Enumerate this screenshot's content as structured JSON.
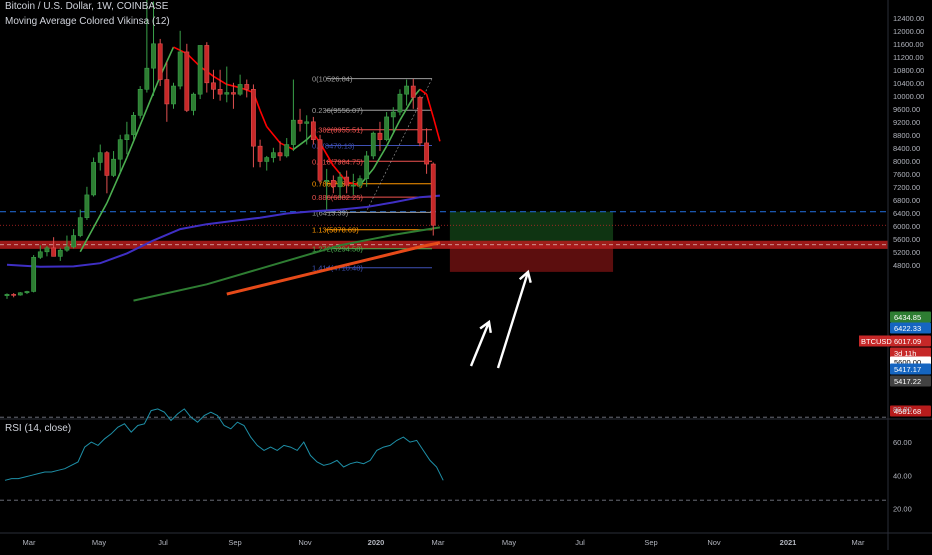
{
  "header": {
    "symbol_line": "Bitcoin / U.S. Dollar, 1W, COINBASE",
    "indicator_line": "Moving Average Colored Vikinsa (12)",
    "rsi_label": "RSI (14, close)"
  },
  "colors": {
    "background": "#000000",
    "bull": "#26a69a",
    "bear": "#ef5350",
    "ma_red": "#ff0000",
    "ma_green": "#2e7d32",
    "ma_blue": "#3f2fc4",
    "ma_orange": "#e64a19",
    "rsi_line": "#1e90a8",
    "long_zone": "#1b5e20",
    "short_zone": "#b71c1c",
    "price_line_red": "#c62828",
    "dashed_blue": "#1e63c4",
    "fib_gray": "#9e9e9e",
    "fib_red": "#ef5350",
    "fib_orange": "#ff9800",
    "fib_blue": "#3f51b5",
    "fib_green": "#4caf50"
  },
  "chart_data": [
    {
      "type": "candlestick",
      "title": "Bitcoin / U.S. Dollar, 1W, COINBASE",
      "x_axis_labels": [
        "Mar",
        "May",
        "Jul",
        "Sep",
        "Nov",
        "2020",
        "Mar",
        "May",
        "Jul",
        "Sep",
        "Nov",
        "2021",
        "Mar"
      ],
      "y_ticks": [
        4800,
        5200,
        5600,
        6000,
        6400,
        6800,
        7200,
        7600,
        8000,
        8400,
        8800,
        9200,
        9600,
        10000,
        10400,
        10800,
        11200,
        11600,
        12000,
        12400
      ],
      "ylim": [
        4580,
        12600
      ],
      "grid": false,
      "candles": [
        [
          3850,
          3920,
          3750,
          3890
        ],
        [
          3890,
          3930,
          3800,
          3870
        ],
        [
          3870,
          3960,
          3850,
          3940
        ],
        [
          3940,
          4000,
          3900,
          3980
        ],
        [
          3980,
          5100,
          3950,
          5030
        ],
        [
          5030,
          5400,
          4980,
          5200
        ],
        [
          5200,
          5380,
          5060,
          5320
        ],
        [
          5320,
          5650,
          5150,
          5060
        ],
        [
          5060,
          5320,
          4920,
          5250
        ],
        [
          5250,
          5700,
          5200,
          5350
        ],
        [
          5350,
          5900,
          5300,
          5700
        ],
        [
          5700,
          6500,
          5650,
          6250
        ],
        [
          6250,
          7200,
          6180,
          6950
        ],
        [
          6950,
          8100,
          6900,
          7950
        ],
        [
          7950,
          8500,
          7700,
          8250
        ],
        [
          8250,
          8300,
          7000,
          7550
        ],
        [
          7550,
          8300,
          7500,
          8050
        ],
        [
          8050,
          8800,
          7600,
          8650
        ],
        [
          8650,
          9200,
          8200,
          8800
        ],
        [
          8800,
          9500,
          8650,
          9400
        ],
        [
          9400,
          10300,
          9300,
          10200
        ],
        [
          10200,
          13800,
          10100,
          10850
        ],
        [
          10850,
          12900,
          10000,
          11600
        ],
        [
          11600,
          11750,
          10300,
          10500
        ],
        [
          10500,
          11050,
          9200,
          9750
        ],
        [
          9750,
          10400,
          9600,
          10300
        ],
        [
          10300,
          12000,
          10200,
          11350
        ],
        [
          11350,
          11600,
          9500,
          9550
        ],
        [
          9550,
          10100,
          9400,
          10050
        ],
        [
          10050,
          11250,
          9900,
          11550
        ],
        [
          11550,
          11650,
          10100,
          10400
        ],
        [
          10400,
          10800,
          9900,
          10200
        ],
        [
          10200,
          10800,
          9850,
          10050
        ],
        [
          10050,
          10900,
          9800,
          10100
        ],
        [
          10100,
          10400,
          9600,
          10050
        ],
        [
          10050,
          10650,
          10000,
          10350
        ],
        [
          10350,
          10500,
          9950,
          10200
        ],
        [
          10200,
          10350,
          7800,
          8450
        ],
        [
          8450,
          8650,
          7800,
          7980
        ],
        [
          7980,
          8150,
          7700,
          8100
        ],
        [
          8100,
          8400,
          7950,
          8250
        ],
        [
          8250,
          8600,
          8000,
          8150
        ],
        [
          8150,
          8700,
          8100,
          8500
        ],
        [
          8500,
          10500,
          8300,
          9250
        ],
        [
          9250,
          9600,
          8900,
          9150
        ],
        [
          9150,
          9400,
          8500,
          9200
        ],
        [
          9200,
          9350,
          8500,
          8650
        ],
        [
          8650,
          8800,
          7300,
          7400
        ],
        [
          7400,
          7750,
          6500,
          7400
        ],
        [
          7400,
          7550,
          7000,
          7200
        ],
        [
          7200,
          7650,
          6850,
          7500
        ],
        [
          7500,
          7700,
          7000,
          7250
        ],
        [
          7250,
          7600,
          6950,
          7250
        ],
        [
          7250,
          7550,
          7150,
          7450
        ],
        [
          7450,
          8300,
          7200,
          8150
        ],
        [
          8150,
          8900,
          8050,
          8850
        ],
        [
          8850,
          9200,
          8300,
          8650
        ],
        [
          8650,
          9500,
          8600,
          9350
        ],
        [
          9350,
          9650,
          8900,
          9500
        ],
        [
          9500,
          10200,
          9400,
          10050
        ],
        [
          10050,
          10500,
          9700,
          10300
        ],
        [
          10300,
          10520,
          9600,
          9950
        ],
        [
          9950,
          10000,
          8450,
          8550
        ],
        [
          8550,
          9000,
          7600,
          7900
        ],
        [
          7900,
          7950,
          5700,
          6017
        ]
      ],
      "moving_average_12": [
        {
          "x": 11,
          "y": 5200
        },
        {
          "x": 15,
          "y": 6700
        },
        {
          "x": 18,
          "y": 8100
        },
        {
          "x": 21,
          "y": 9600
        },
        {
          "x": 23,
          "y": 10600
        },
        {
          "x": 25,
          "y": 11500
        },
        {
          "x": 27,
          "y": 11300
        },
        {
          "x": 29,
          "y": 10900
        },
        {
          "x": 31,
          "y": 10600
        },
        {
          "x": 33,
          "y": 10350
        },
        {
          "x": 35,
          "y": 10250
        },
        {
          "x": 37,
          "y": 10100
        },
        {
          "x": 38,
          "y": 9550
        },
        {
          "x": 39,
          "y": 9050
        },
        {
          "x": 41,
          "y": 8550
        },
        {
          "x": 43,
          "y": 8350
        },
        {
          "x": 45,
          "y": 8650
        },
        {
          "x": 46,
          "y": 8850
        },
        {
          "x": 47,
          "y": 8550
        },
        {
          "x": 49,
          "y": 7850
        },
        {
          "x": 51,
          "y": 7350
        },
        {
          "x": 53,
          "y": 7250
        },
        {
          "x": 55,
          "y": 7750
        },
        {
          "x": 57,
          "y": 8450
        },
        {
          "x": 59,
          "y": 9250
        },
        {
          "x": 61,
          "y": 9950
        },
        {
          "x": 62,
          "y": 10200
        },
        {
          "x": 63,
          "y": 10050
        },
        {
          "x": 64,
          "y": 9350
        },
        {
          "x": 65,
          "y": 8600
        }
      ],
      "ma_blue": [
        {
          "x": 0,
          "y": 4800
        },
        {
          "x": 5,
          "y": 4740
        },
        {
          "x": 10,
          "y": 4750
        },
        {
          "x": 14,
          "y": 4850
        },
        {
          "x": 18,
          "y": 5150
        },
        {
          "x": 22,
          "y": 5550
        },
        {
          "x": 26,
          "y": 5900
        },
        {
          "x": 30,
          "y": 6050
        },
        {
          "x": 34,
          "y": 6150
        },
        {
          "x": 38,
          "y": 6250
        },
        {
          "x": 42,
          "y": 6380
        },
        {
          "x": 46,
          "y": 6450
        },
        {
          "x": 50,
          "y": 6500
        },
        {
          "x": 54,
          "y": 6580
        },
        {
          "x": 58,
          "y": 6720
        },
        {
          "x": 62,
          "y": 6880
        },
        {
          "x": 65,
          "y": 6930
        }
      ],
      "ma_green": [
        {
          "x": 19,
          "y": 3700
        },
        {
          "x": 30,
          "y": 4200
        },
        {
          "x": 40,
          "y": 4800
        },
        {
          "x": 50,
          "y": 5400
        },
        {
          "x": 58,
          "y": 5720
        },
        {
          "x": 65,
          "y": 5950
        }
      ],
      "ma_orange": [
        {
          "x": 33,
          "y": 3900
        },
        {
          "x": 45,
          "y": 4500
        },
        {
          "x": 55,
          "y": 5000
        },
        {
          "x": 62,
          "y": 5350
        },
        {
          "x": 65,
          "y": 5480
        }
      ],
      "fib_levels": [
        {
          "label": "0(10526.84)",
          "price": 10526.84,
          "color": "#9e9e9e"
        },
        {
          "label": "0.236(9556.07)",
          "price": 9556.07,
          "color": "#9e9e9e"
        },
        {
          "label": "0.382(8955.51)",
          "price": 8955.51,
          "color": "#ef5350"
        },
        {
          "label": "0.5(8470.13)",
          "price": 8470.13,
          "color": "#3f51b5"
        },
        {
          "label": "0.618(7984.75)",
          "price": 7984.75,
          "color": "#ef5350"
        },
        {
          "label": "0.786(7294.58)",
          "price": 7294.58,
          "color": "#ff9800"
        },
        {
          "label": "0.886(6882.25)",
          "price": 6882.25,
          "color": "#ef5350"
        },
        {
          "label": "1(6413.39)",
          "price": 6413.39,
          "color": "#9e9e9e"
        },
        {
          "label": "1.13(5878.69)",
          "price": 5878.69,
          "color": "#ff9800"
        },
        {
          "label": "1.272(5294.58)",
          "price": 5294.58,
          "color": "#4caf50"
        },
        {
          "label": "1.414(4710.48)",
          "price": 4710.48,
          "color": "#3f51b5"
        }
      ],
      "price_labels": [
        {
          "text": "6434.85",
          "price": 6434.85,
          "bg": "#2e7d32",
          "fg": "#ffffff"
        },
        {
          "text": "6422.33",
          "price": 6422.33,
          "bg": "#1565c0",
          "fg": "#ffffff"
        },
        {
          "text": "6017.09",
          "price": 6017.09,
          "bg": "#c62828",
          "fg": "#ffffff",
          "tag": "BTCUSD"
        },
        {
          "text": "3d 11h",
          "price": 5780,
          "bg": "#c62828",
          "fg": "#ffffff"
        },
        {
          "text": "5600.00",
          "price": 5600,
          "bg": "#ffffff",
          "fg": "#000000"
        },
        {
          "text": "5417.17",
          "price": 5417.17,
          "bg": "#1565c0",
          "fg": "#ffffff"
        },
        {
          "text": "5417.22",
          "price": 5417.22,
          "bg": "#424242",
          "fg": "#ffffff"
        },
        {
          "text": "4581.68",
          "price": 4581.68,
          "bg": "#b71c1c",
          "fg": "#ffffff"
        }
      ],
      "position": {
        "entry": 5417.2,
        "target": 6434.85,
        "stop": 4581.68,
        "x_start": 66.5,
        "x_end": 91
      }
    },
    {
      "type": "line",
      "title": "RSI (14, close)",
      "y_ticks": [
        20,
        40,
        60,
        80
      ],
      "ylim": [
        19,
        86
      ],
      "bands": [
        75,
        25
      ],
      "series": [
        {
          "values": [
            37,
            38,
            38,
            39,
            40,
            41,
            42,
            42,
            43,
            44,
            46,
            48,
            57,
            60,
            58,
            62,
            65,
            69,
            71,
            66,
            70,
            71,
            79,
            80,
            78,
            73,
            77,
            80,
            75,
            72,
            76,
            78,
            76,
            70,
            68,
            72,
            70,
            63,
            58,
            55,
            57,
            55,
            58,
            57,
            55,
            60,
            52,
            48,
            46,
            47,
            49,
            45,
            47,
            48,
            47,
            49,
            55,
            57,
            58,
            61,
            63,
            60,
            61,
            55,
            49,
            45,
            37
          ]
        }
      ]
    }
  ]
}
